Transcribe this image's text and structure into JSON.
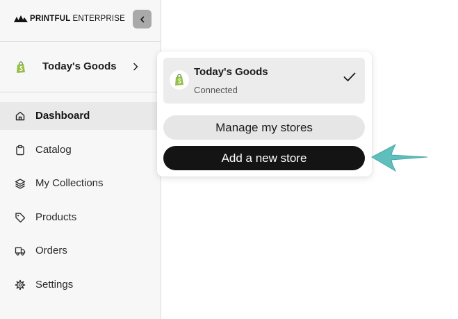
{
  "logo": {
    "brand": "PRINTFUL",
    "suffix": "ENTERPRISE"
  },
  "sidebar": {
    "collapse_icon": "chevron-left-icon",
    "store": {
      "name": "Today's Goods",
      "icon": "shopify-icon"
    },
    "items": [
      {
        "label": "Dashboard",
        "icon": "home-icon",
        "active": true
      },
      {
        "label": "Catalog",
        "icon": "clipboard-icon"
      },
      {
        "label": "My Collections",
        "icon": "layers-icon"
      },
      {
        "label": "Products",
        "icon": "tag-icon"
      },
      {
        "label": "Orders",
        "icon": "truck-icon"
      },
      {
        "label": "Settings",
        "icon": "gear-icon"
      }
    ]
  },
  "dropdown": {
    "store": {
      "name": "Today's Goods",
      "status": "Connected",
      "selected": true
    },
    "manage_label": "Manage my stores",
    "add_label": "Add a new store"
  },
  "colors": {
    "sidebar_bg": "#f7f7f7",
    "active_item_bg": "#e9e9e9",
    "primary_button": "#141414",
    "secondary_button": "#e6e6e6",
    "shopify_green": "#95bf47",
    "annotation_arrow": "#5fbfbd"
  }
}
